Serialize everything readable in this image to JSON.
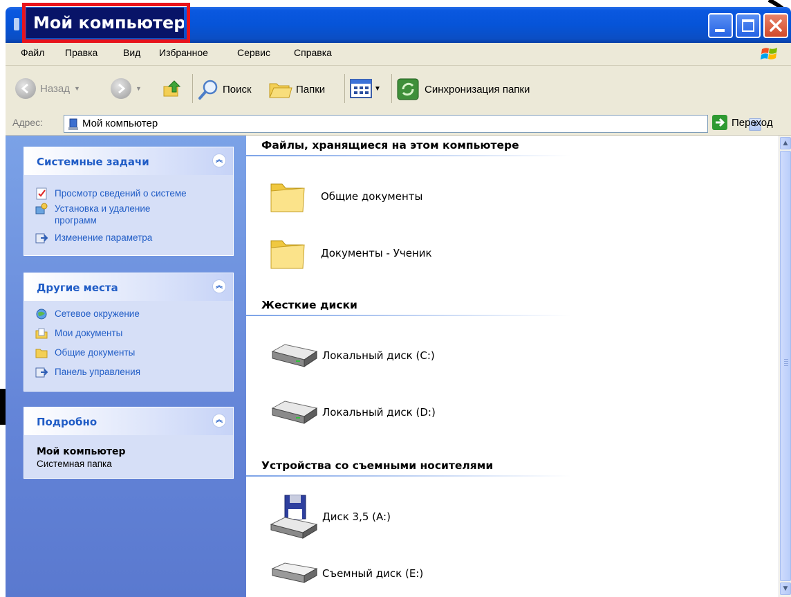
{
  "window": {
    "title": "Мой компьютер",
    "colors": {
      "titlebar": "#0654d8",
      "highlight_border": "#e8141c",
      "title_bg": "#081468",
      "panel_link": "#215dc6"
    }
  },
  "menu": {
    "items": [
      "Файл",
      "Правка",
      "Вид",
      "Избранное",
      "Сервис",
      "Справка"
    ]
  },
  "toolbar": {
    "back_label": "Назад",
    "search_label": "Поиск",
    "folders_label": "Папки",
    "sync_label": "Синхронизация папки"
  },
  "address": {
    "label": "Адрес:",
    "value": "Мой компьютер",
    "go_label": "Переход"
  },
  "sidebar": {
    "system_tasks": {
      "title": "Системные задачи",
      "items": [
        {
          "label": "Просмотр сведений о системе",
          "icon": "system-info-icon"
        },
        {
          "label": "Установка и удаление\nпрограмм",
          "icon": "add-remove-programs-icon"
        },
        {
          "label": "Изменение параметра",
          "icon": "control-panel-icon"
        }
      ]
    },
    "other_places": {
      "title": "Другие места",
      "items": [
        {
          "label": "Сетевое окружение",
          "icon": "network-icon"
        },
        {
          "label": "Мои документы",
          "icon": "my-documents-icon"
        },
        {
          "label": "Общие документы",
          "icon": "folder-icon"
        },
        {
          "label": "Панель управления",
          "icon": "control-panel-icon"
        }
      ]
    },
    "details": {
      "title": "Подробно",
      "name": "Мой компьютер",
      "type": "Системная папка"
    }
  },
  "content": {
    "sections": [
      {
        "title": "Файлы, хранящиеся на этом компьютере",
        "items": [
          {
            "label": "Общие документы",
            "icon": "folder-icon"
          },
          {
            "label": "Документы - Ученик",
            "icon": "folder-icon"
          }
        ]
      },
      {
        "title": "Жесткие диски",
        "items": [
          {
            "label": "Локальный диск (C:)",
            "icon": "hard-drive-icon"
          },
          {
            "label": "Локальный диск (D:)",
            "icon": "hard-drive-icon"
          }
        ]
      },
      {
        "title": "Устройства со съемными носителями",
        "items": [
          {
            "label": "Диск 3,5 (A:)",
            "icon": "floppy-drive-icon"
          },
          {
            "label": "Съемный диск (E:)",
            "icon": "removable-drive-icon"
          }
        ]
      }
    ]
  }
}
